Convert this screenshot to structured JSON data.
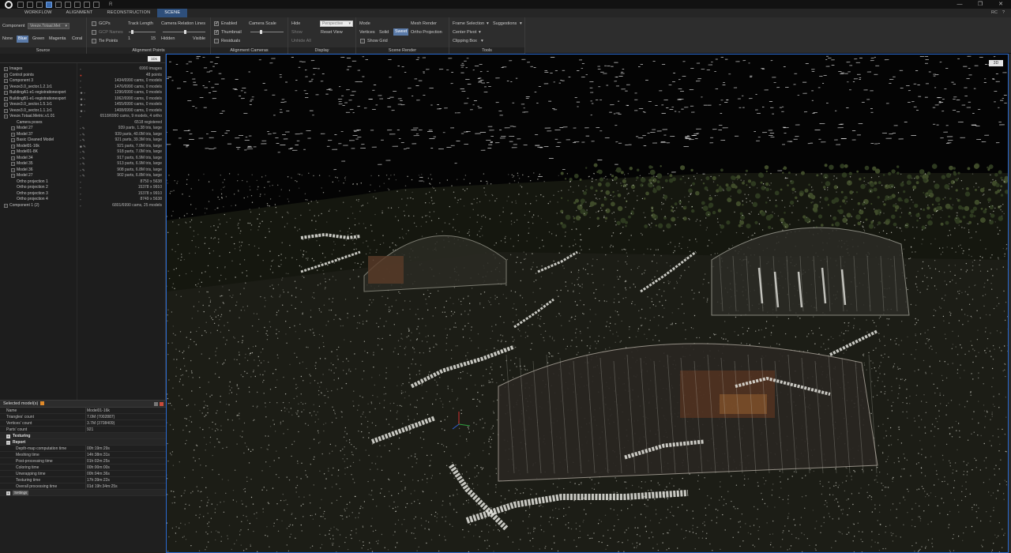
{
  "titlebar": {
    "title": "R",
    "icons": [
      "new-icon",
      "open-icon",
      "save-icon",
      "layout-1-icon",
      "layout-2-icon",
      "layout-3-icon",
      "undo-icon",
      "redo-icon",
      "settings-icon"
    ],
    "win_minimize": "—",
    "win_restore": "❐",
    "win_close": "✕"
  },
  "tabs": [
    {
      "label": "WORKFLOW",
      "active": false
    },
    {
      "label": "ALIGNMENT",
      "active": false
    },
    {
      "label": "RECONSTRUCTION",
      "active": false
    },
    {
      "label": "SCENE",
      "active": true
    }
  ],
  "tabs_right": [
    "RC",
    "?"
  ],
  "ribbon": {
    "source": {
      "title": "Source",
      "component_label": "Component",
      "component_value": "Veeze.Totaal.Met",
      "colors": [
        "None",
        "Blue",
        "Green",
        "Magenta",
        "Coral"
      ],
      "active_color": "Blue"
    },
    "alignment_points": {
      "title": "Alignment Points",
      "gcps": "GCPs",
      "gcp_names": "GCP Names",
      "tie_points": "Tie Points",
      "track_length": "Track Length",
      "track_min": "1",
      "track_max": "15"
    },
    "alignment_cameras": {
      "title": "Alignment Cameras",
      "relation_lines": "Camera Relation Lines",
      "hidden": "Hidden",
      "visible": "Visible",
      "enabled": "Enabled",
      "thumbnail": "Thumbnail",
      "residuals": "Residuals",
      "camera_scale": "Camera Scale"
    },
    "display": {
      "title": "Display",
      "hide": "Hide",
      "show": "Show",
      "unhide_all": "Unhide All",
      "projection_value": "Perspective",
      "reset_view": "Reset View"
    },
    "scene_render": {
      "title": "Scene Render",
      "mode": "Mode",
      "vertices": "Vertices",
      "solid": "Solid",
      "sweet": "Sweet",
      "show_grid": "Show Grid",
      "mesh_render": "Mesh Render",
      "ortho_projection": "Ortho Projection"
    },
    "tools": {
      "title": "Tools",
      "frame_selection": "Frame Selection",
      "suggestions": "Suggestions",
      "center_pivot": "Center Pivot",
      "clipping_box": "Clipping Box"
    }
  },
  "tree": {
    "top_button": "1Ds",
    "rows": [
      {
        "name": "Images",
        "indent": 0,
        "exp": "+",
        "icon": "image-icon",
        "glyph": "▫",
        "value": "6990 images"
      },
      {
        "name": "Control points",
        "indent": 0,
        "exp": "+",
        "icon": "control-point-icon",
        "glyph": "●",
        "value": "48 points"
      },
      {
        "name": "Component 3",
        "indent": 0,
        "exp": "+",
        "icon": "component-icon",
        "glyph": "▫",
        "value": "1434/6990 cams, 0 models"
      },
      {
        "name": "Veeze3.0_sector.1.2.1r1",
        "indent": 0,
        "exp": "+",
        "icon": "component-icon",
        "glyph": "▫",
        "value": "1476/6990 cams, 0 models"
      },
      {
        "name": "BuildingA1-e1-registrationexport",
        "indent": 0,
        "exp": "+",
        "icon": "component-icon",
        "glyph": "★ ▫",
        "value": "1296/6990 cams, 0 models"
      },
      {
        "name": "BuildingB1-e1-registrationexport",
        "indent": 0,
        "exp": "+",
        "icon": "component-icon",
        "glyph": "★ ▫",
        "value": "1062/6990 cams, 0 models"
      },
      {
        "name": "Veeze3.0_sector.1.5.1r1",
        "indent": 0,
        "exp": "+",
        "icon": "component-icon",
        "glyph": "★ ▫",
        "value": "1455/6990 cams, 0 models"
      },
      {
        "name": "Veeze3.0_sector.1.1.1r1",
        "indent": 0,
        "exp": "+",
        "icon": "component-icon",
        "glyph": "★ ▫",
        "value": "1408/6990 cams, 0 models"
      },
      {
        "name": "Veeze.Totaal.Metric.v1.01",
        "indent": 0,
        "exp": "−",
        "icon": "component-icon",
        "glyph": "▫",
        "value": "6518/6990 cams, 9 models, 4 ortho"
      },
      {
        "name": "Camera poses",
        "indent": 1,
        "exp": "",
        "icon": "camera-icon",
        "glyph": "",
        "value": "6518 registered"
      },
      {
        "name": "Model 27",
        "indent": 1,
        "exp": "+",
        "icon": "model-icon",
        "glyph": "▫ ✎",
        "value": "939 parts, 1.38 tris, large"
      },
      {
        "name": "Model 37",
        "indent": 1,
        "exp": "+",
        "icon": "model-icon",
        "glyph": "▫ ✎",
        "value": "939 parts, 40.0M tris, large"
      },
      {
        "name": "Basic Cleaned Model",
        "indent": 1,
        "exp": "+",
        "icon": "model-icon",
        "glyph": "▫ ✎",
        "value": "921 parts, 39.3M tris, large"
      },
      {
        "name": "Model01-16k",
        "indent": 1,
        "exp": "+",
        "icon": "model-icon",
        "glyph": "■ ✎",
        "value": "921 parts, 7.0M tris, large"
      },
      {
        "name": "Model01-8K",
        "indent": 1,
        "exp": "+",
        "icon": "model-icon",
        "glyph": "▫ ✎",
        "value": "918 parts, 7.0M tris, large"
      },
      {
        "name": "Model 34",
        "indent": 1,
        "exp": "+",
        "icon": "model-icon",
        "glyph": "▫ ✎",
        "value": "917 parts, 6.9M tris, large"
      },
      {
        "name": "Model 35",
        "indent": 1,
        "exp": "+",
        "icon": "model-icon",
        "glyph": "▫ ✎",
        "value": "913 parts, 6.9M tris, large"
      },
      {
        "name": "Model 36",
        "indent": 1,
        "exp": "+",
        "icon": "model-icon",
        "glyph": "▫ ✎",
        "value": "908 parts, 6.8M tris, large"
      },
      {
        "name": "Model 27",
        "indent": 1,
        "exp": "+",
        "icon": "model-icon",
        "glyph": "▫ ✎",
        "value": "902 parts, 6.8M tris, large"
      },
      {
        "name": "Ortho projection 1",
        "indent": 1,
        "exp": "",
        "icon": "ortho-icon",
        "glyph": "▫",
        "value": "8750 x 5638"
      },
      {
        "name": "Ortho projection 2",
        "indent": 1,
        "exp": "",
        "icon": "ortho-icon",
        "glyph": "▫",
        "value": "15378 x 9910"
      },
      {
        "name": "Ortho projection 3",
        "indent": 1,
        "exp": "",
        "icon": "ortho-icon",
        "glyph": "▫",
        "value": "15378 x 9910"
      },
      {
        "name": "Ortho projection 4",
        "indent": 1,
        "exp": "",
        "icon": "ortho-icon",
        "glyph": "▫",
        "value": "8749 x 5638"
      },
      {
        "name": "Component 1 (2)",
        "indent": 0,
        "exp": "+",
        "icon": "component-icon",
        "glyph": "▫",
        "value": "6801/6990 cams, 25 models"
      }
    ]
  },
  "props": {
    "header": "Selected model(s)",
    "rows": [
      {
        "key": "Name",
        "value": "Model01-16k",
        "kind": "plain"
      },
      {
        "key": "Triangles' count",
        "value": "7.0M (7002887)",
        "kind": "plain"
      },
      {
        "key": "Vertices' count",
        "value": "3.7M (3708409)",
        "kind": "plain"
      },
      {
        "key": "Parts' count",
        "value": "921",
        "kind": "plain"
      },
      {
        "key": "Texturing",
        "value": "",
        "kind": "section",
        "sign": "+"
      },
      {
        "key": "Report",
        "value": "",
        "kind": "section",
        "sign": "−"
      },
      {
        "key": "Depth-map computation time",
        "value": "00h:19m:29s",
        "kind": "sub"
      },
      {
        "key": "Meshing time",
        "value": "14h:38m:31s",
        "kind": "sub"
      },
      {
        "key": "Post-processing time",
        "value": "01h:02m:25s",
        "kind": "sub"
      },
      {
        "key": "Coloring time",
        "value": "00h:00m:00s",
        "kind": "sub"
      },
      {
        "key": "Unwrapping time",
        "value": "00h:04m:36s",
        "kind": "sub"
      },
      {
        "key": "Texturing time",
        "value": "17h:39m:22s",
        "kind": "sub"
      },
      {
        "key": "Overall processing time",
        "value": "01d 19h:34m:25s",
        "kind": "sub"
      }
    ],
    "settings_label": "Settings"
  },
  "viewport": {
    "badge": "3D"
  },
  "colors": {
    "accent": "#2e4f7b",
    "highlight": "#5a7aa8",
    "viewport_border": "#2a6ad0"
  }
}
